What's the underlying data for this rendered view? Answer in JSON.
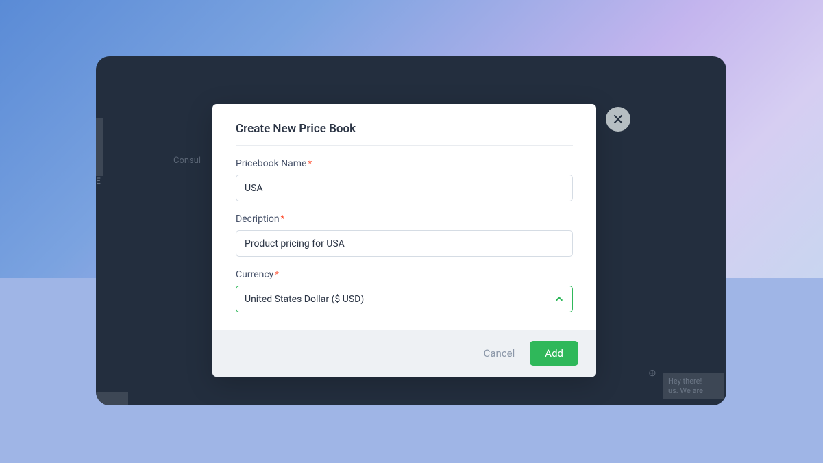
{
  "modal": {
    "title": "Create New Price Book",
    "fields": {
      "name": {
        "label": "Pricebook Name",
        "value": "USA"
      },
      "description": {
        "label": "Decription",
        "value": "Product pricing for USA"
      },
      "currency": {
        "label": "Currency",
        "value": "United States Dollar ($ USD)"
      }
    },
    "actions": {
      "cancel": "Cancel",
      "submit": "Add"
    }
  },
  "background": {
    "consult_fragment": "Consul",
    "e_fragment": "E",
    "chat_fragment": "Hey there!",
    "chat_fragment_2": "us. We are",
    "circle_plus": "⊕"
  }
}
